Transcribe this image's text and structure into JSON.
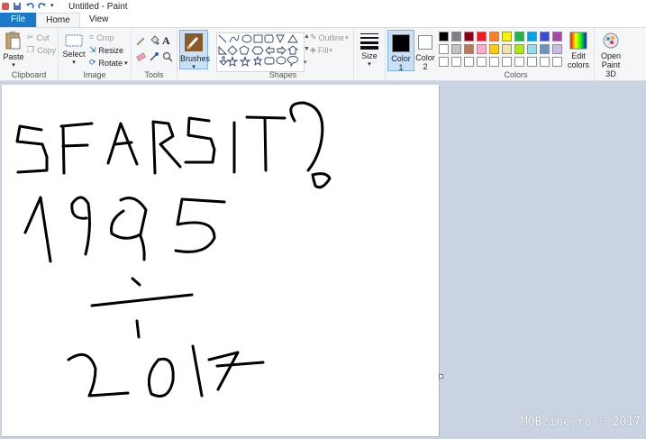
{
  "window": {
    "title": "Untitled - Paint"
  },
  "tabs": [
    {
      "label": "File"
    },
    {
      "label": "Home"
    },
    {
      "label": "View"
    }
  ],
  "ribbon": {
    "clipboard": {
      "label": "Clipboard",
      "paste": "Paste",
      "cut": "Cut",
      "copy": "Copy"
    },
    "image": {
      "label": "Image",
      "select": "Select",
      "crop": "Crop",
      "resize": "Resize",
      "rotate": "Rotate"
    },
    "tools": {
      "label": "Tools"
    },
    "brushes": {
      "label": "Brushes"
    },
    "shapes": {
      "label": "Shapes",
      "outline": "Outline",
      "fill": "Fill"
    },
    "size": {
      "label": "Size"
    },
    "color1": {
      "label": "Color",
      "num": "1"
    },
    "color2": {
      "label": "Color",
      "num": "2"
    },
    "colors": {
      "label": "Colors",
      "edit_label": "Edit",
      "edit_label2": "colors",
      "row1": [
        "#000000",
        "#7f7f7f",
        "#880015",
        "#ed1c24",
        "#ff7f27",
        "#fff200",
        "#22b14c",
        "#00a2e8",
        "#3f48cc",
        "#a349a4"
      ],
      "row2": [
        "#ffffff",
        "#c3c3c3",
        "#b97a57",
        "#ffaec9",
        "#ffc90e",
        "#efe4b0",
        "#b5e61d",
        "#99d9ea",
        "#7092be",
        "#c8bfe7"
      ],
      "row3": [
        "#ffffff",
        "#ffffff",
        "#ffffff",
        "#ffffff",
        "#ffffff",
        "#ffffff",
        "#ffffff",
        "#ffffff",
        "#ffffff",
        "#ffffff"
      ]
    },
    "paint3d": {
      "label": "Open",
      "label2": "Paint 3D"
    }
  },
  "watermark": "MOBzine.ro © 2017"
}
